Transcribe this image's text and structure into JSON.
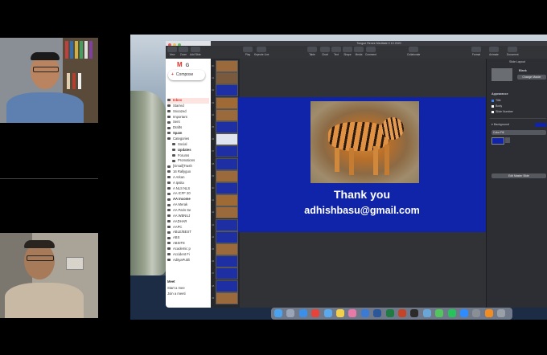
{
  "participants": [
    {
      "name": "participant-top"
    },
    {
      "name": "participant-bottom"
    }
  ],
  "gmail": {
    "logo_letter": "M",
    "logo_text": "G",
    "compose_label": "Compose",
    "items": [
      {
        "label": "Inbox",
        "bold": true,
        "active": true
      },
      {
        "label": "Starred"
      },
      {
        "label": "Snoozed"
      },
      {
        "label": "Important"
      },
      {
        "label": "Sent"
      },
      {
        "label": "Drafts"
      },
      {
        "label": "Spam",
        "bold": true
      },
      {
        "label": "Categories"
      },
      {
        "label": "Social",
        "indent": true
      },
      {
        "label": "Updates",
        "indent": true,
        "bold": true
      },
      {
        "label": "Forums",
        "indent": true
      },
      {
        "label": "Promotions",
        "indent": true
      },
      {
        "label": "[Gmail]Trash"
      },
      {
        "label": "16 Rallyguo"
      },
      {
        "label": "A Arkan"
      },
      {
        "label": "A Ipsita"
      },
      {
        "label": "A NLS NLS"
      },
      {
        "label": "AA ICFF 20"
      },
      {
        "label": "AA Income",
        "bold": true
      },
      {
        "label": "AA Merak"
      },
      {
        "label": "AA Paris Se"
      },
      {
        "label": "AA WBNUJ"
      },
      {
        "label": "AADHAR"
      },
      {
        "label": "AAPC"
      },
      {
        "label": "ABLE/BEST"
      },
      {
        "label": "ABS"
      },
      {
        "label": "ABSITE"
      },
      {
        "label": "Academic p"
      },
      {
        "label": "Accident Fi"
      },
      {
        "label": "AdityaPubli"
      }
    ],
    "meet_header": "Meet",
    "meet_items": [
      "Start a mee",
      "Join a meeti"
    ]
  },
  "keynote": {
    "window_title": "Tongue Renee Meditate 0 10 2020",
    "toolbar": [
      "View",
      "Zoom",
      "Add Slide",
      "Play",
      "Keynote Live",
      "Table",
      "Chart",
      "Text",
      "Shape",
      "Media",
      "Comment",
      "Collaborate",
      "Format",
      "Animate",
      "Document"
    ],
    "slide_numbers": [
      "30",
      "31",
      "32",
      "33",
      "34",
      "35",
      "36",
      "37",
      "38",
      "39",
      "40",
      "41",
      "42",
      "43",
      "44",
      "45",
      "46",
      "47",
      "48",
      "49"
    ],
    "slide": {
      "title": "Thank you",
      "subtitle": "adhishbasu@gmail.com",
      "background_color": "#0f24a8"
    },
    "inspector": {
      "tab": "Slide Layout",
      "layout_name": "Blank",
      "change_master_label": "Change Master",
      "appearance_header": "Appearance",
      "options": [
        {
          "label": "Title",
          "checked": true
        },
        {
          "label": "Body",
          "checked": false
        },
        {
          "label": "Slide Number",
          "checked": false
        }
      ],
      "background_label": "Background",
      "fill_option": "Color Fill",
      "fill_color": "#0f24a8",
      "edit_master_label": "Edit Master Slide"
    }
  },
  "dock": {
    "icons": [
      "finder-icon",
      "launchpad-icon",
      "safari-icon",
      "chrome-icon",
      "mail-icon",
      "notes-icon",
      "photos-icon",
      "keynote-icon",
      "word-icon",
      "excel-icon",
      "powerpoint-icon",
      "terminal-icon",
      "preview-icon",
      "messages-icon",
      "whatsapp-icon",
      "zoom-icon",
      "settings-icon",
      "vlc-icon",
      "trash-icon"
    ],
    "colors": [
      "#4aa3f0",
      "#9aa6b8",
      "#3b8fe8",
      "#e6443a",
      "#5aa9ef",
      "#f2d04c",
      "#e97aa8",
      "#3b7bd6",
      "#2b579a",
      "#1f7a44",
      "#c4442a",
      "#2b2b2b",
      "#6aa7d8",
      "#52c55c",
      "#25c35a",
      "#2d8cff",
      "#8a8e95",
      "#f28b20",
      "#9aa0a8"
    ]
  }
}
